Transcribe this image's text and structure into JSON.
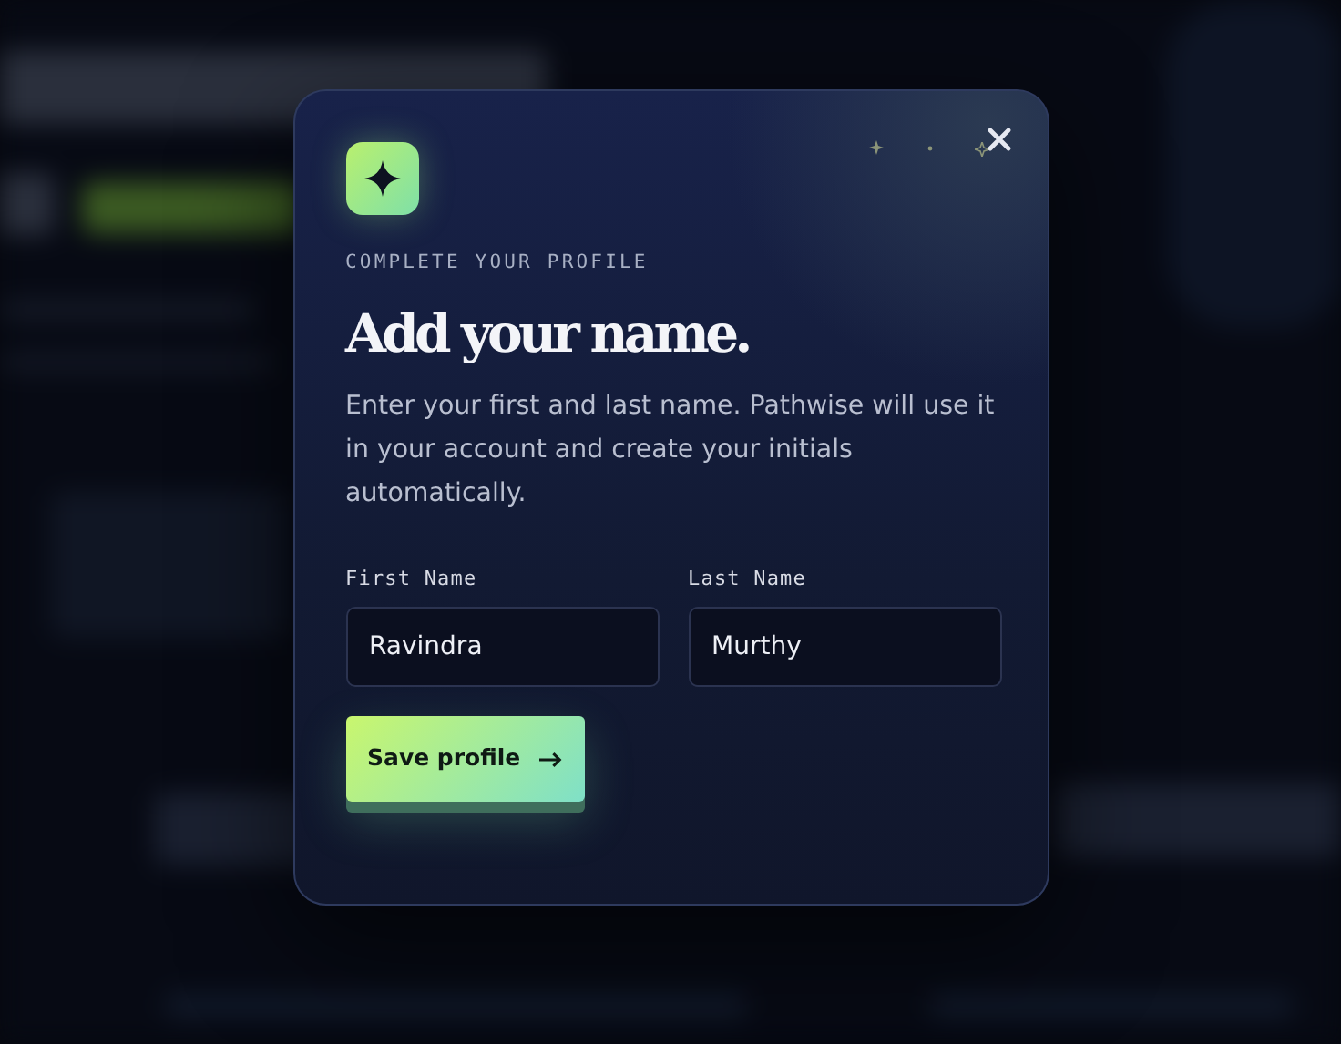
{
  "dialog": {
    "eyebrow": "COMPLETE YOUR PROFILE",
    "title": "Add your name.",
    "description": "Enter your first and last name. Pathwise will use it in your account and create your initials automatically.",
    "fields": [
      {
        "label": "First Name",
        "value": "Ravindra"
      },
      {
        "label": "Last Name",
        "value": "Murthy"
      }
    ],
    "submit_button": {
      "label": "Save profile"
    }
  }
}
